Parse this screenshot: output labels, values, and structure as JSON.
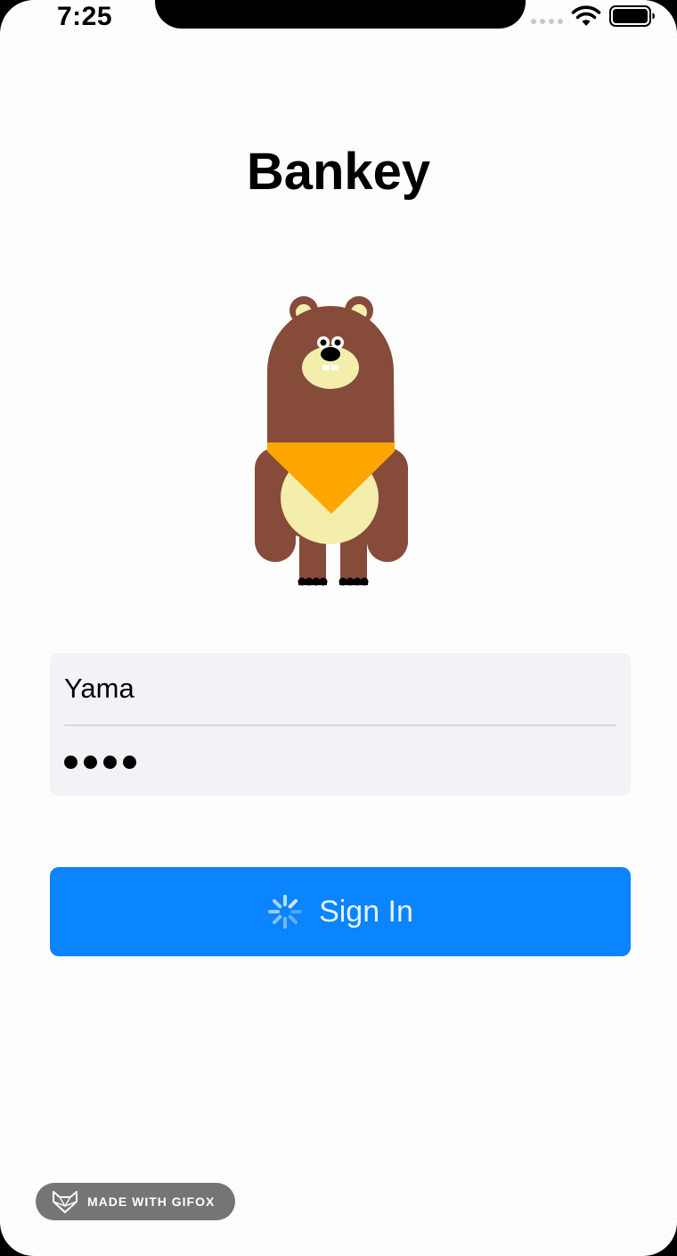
{
  "status_bar": {
    "time": "7:25"
  },
  "app": {
    "title": "Bankey"
  },
  "login_form": {
    "username_value": "Yama",
    "password_masked_length": 4
  },
  "signin_button": {
    "label": "Sign In",
    "loading": true
  },
  "watermark": {
    "text": "MADE WITH GIFOX"
  },
  "icons": {
    "wifi": "wifi-icon",
    "battery": "battery-icon",
    "spinner": "activity-spinner-icon",
    "mascot": "bear-mascot",
    "watermark_logo": "fox-logo-icon"
  },
  "colors": {
    "accent": "#0a84ff",
    "field_background": "#f2f2f7",
    "bear_brown": "#874b3a",
    "bear_cream": "#f3eeac",
    "bandana_orange": "#ffa500"
  }
}
